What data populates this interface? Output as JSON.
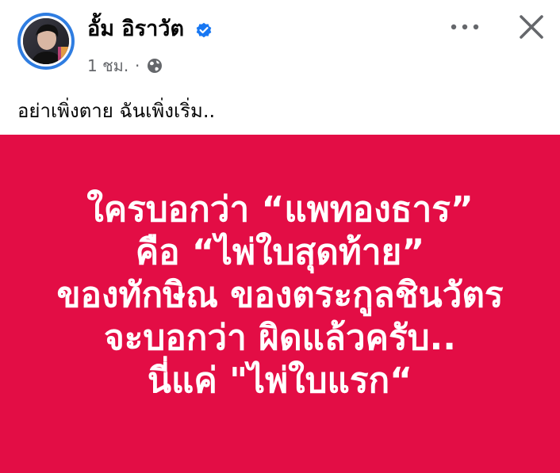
{
  "post": {
    "author": "อั้ม อิราวัต",
    "time": "1 ชม.",
    "separator": "·",
    "caption": "อย่าเพิ่งตาย ฉันเพิ่งเริ่ม.."
  },
  "image_card": {
    "lines": [
      "ใครบอกว่า “แพทองธาร”",
      "คือ “ไพ่ใบสุดท้าย”",
      "ของทักษิณ ของตระกูลชินวัตร",
      "จะบอกว่า ผิดแล้วครับ..",
      "นี่แค่ \"ไพ่ใบแรก“"
    ]
  },
  "colors": {
    "card_background": "#e30d45",
    "card_text": "#ffffff",
    "verified_badge": "#1877f2",
    "meta_text": "#65676b"
  },
  "icons": {
    "verified": "verified-badge-icon",
    "privacy": "globe-icon",
    "more": "more-options-icon",
    "close": "close-icon"
  }
}
